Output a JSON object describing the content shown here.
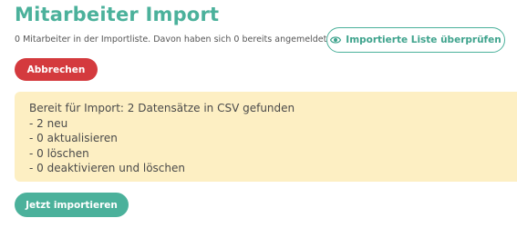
{
  "page": {
    "title": "Mitarbeiter Import",
    "subtitle": "0 Mitarbeiter in der Importliste. Davon haben sich 0 bereits angemeldet."
  },
  "actions": {
    "review_label": "Importierte Liste überprüfen",
    "review_icon": "eye-icon",
    "cancel_label": "Abbrechen",
    "import_label": "Jetzt importieren"
  },
  "summary": {
    "lines": [
      "Bereit für Import: 2 Datensätze in CSV gefunden",
      "- 2 neu",
      "- 0 aktualisieren",
      "- 0 löschen",
      "- 0 deaktivieren und löschen"
    ]
  },
  "colors": {
    "accent": "#4bb19b",
    "danger": "#d43a3e",
    "notice_bg": "#fdefc3"
  }
}
